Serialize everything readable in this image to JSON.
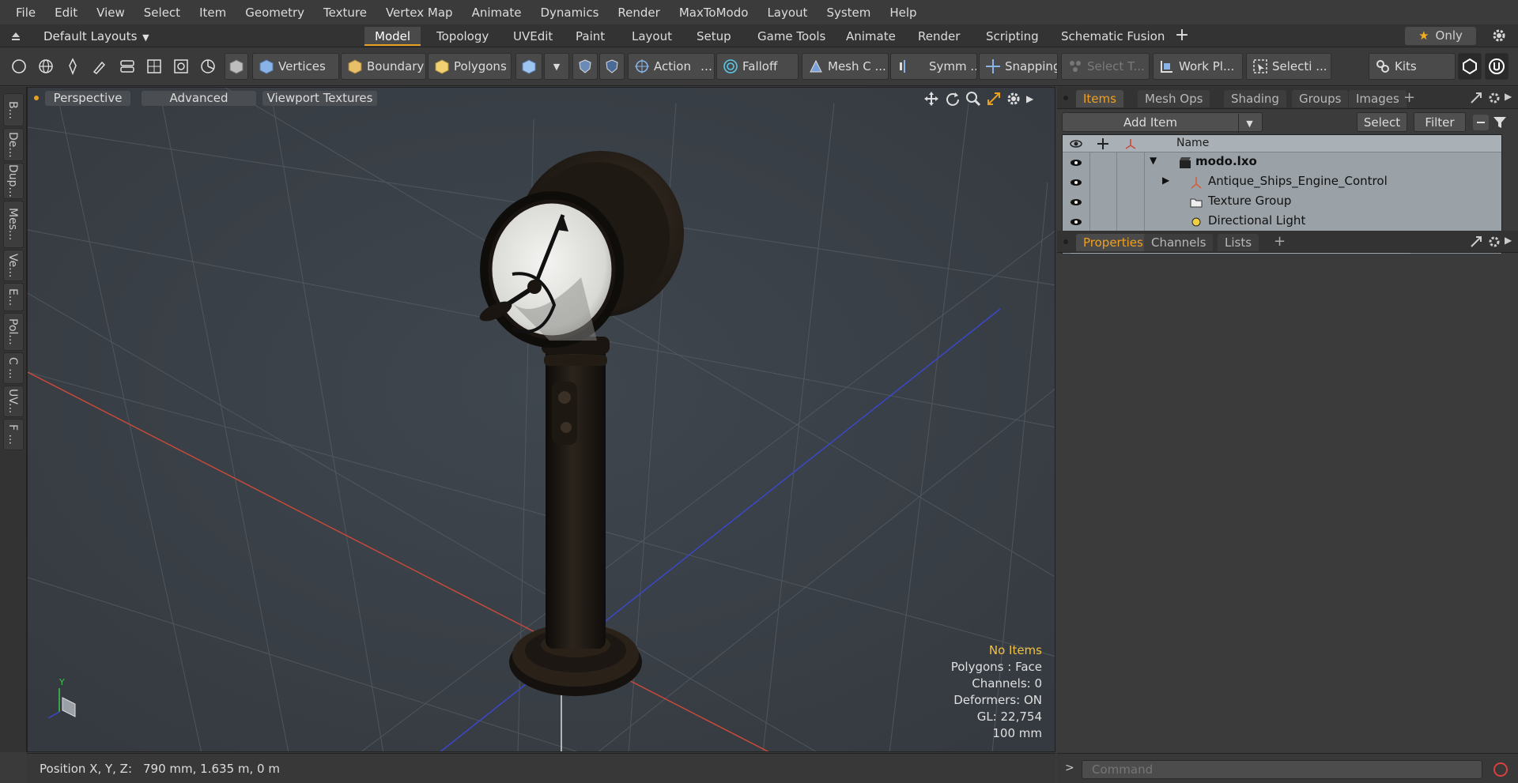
{
  "menubar": {
    "items": [
      "File",
      "Edit",
      "View",
      "Select",
      "Item",
      "Geometry",
      "Texture",
      "Vertex Map",
      "Animate",
      "Dynamics",
      "Render",
      "MaxToModo",
      "Layout",
      "System",
      "Help"
    ]
  },
  "layoutbar": {
    "layouts_label": "Default Layouts",
    "tabs": [
      "Model",
      "Topology",
      "UVEdit",
      "Paint",
      "Layout",
      "Setup",
      "Game Tools",
      "Animate",
      "Render",
      "Scripting",
      "Schematic Fusion"
    ],
    "active_tab": "Model",
    "only_label": "Only"
  },
  "toolbar": {
    "vertices": "Vertices",
    "boundary": "Boundary",
    "polygons": "Polygons",
    "action": "Action",
    "falloff": "Falloff",
    "mesh": "Mesh C ...",
    "symmetry": "Symm ...",
    "snapping": "Snapping",
    "select_t": "Select T...",
    "workplane": "Work Pl...",
    "selection": "Selecti ...",
    "kits": "Kits"
  },
  "leftstrip": {
    "tabs": [
      "B...",
      "De...",
      "Dup...",
      "Mes...",
      "Ve...",
      "E...",
      "Pol...",
      "C ...",
      "UV...",
      "F ..."
    ]
  },
  "viewport": {
    "perspective": "Perspective",
    "advanced": "Advanced",
    "viewport_textures": "Viewport Textures",
    "info": {
      "no_items": "No Items",
      "polygons": "Polygons : Face",
      "channels": "Channels: 0",
      "deformers": "Deformers: ON",
      "gl": "GL: 22,754",
      "scale": "100 mm"
    }
  },
  "statusbar": {
    "label": "Position X, Y, Z:",
    "value": "790 mm, 1.635 m, 0 m"
  },
  "items_panel": {
    "tabs": [
      "Items",
      "Mesh Ops",
      "Shading",
      "Groups",
      "Images"
    ],
    "active_tab": "Items",
    "add_item": "Add Item",
    "select": "Select",
    "filter": "Filter",
    "column_name": "Name",
    "rows": [
      {
        "label": "modo.lxo",
        "bold": true
      },
      {
        "label": "Antique_Ships_Engine_Control",
        "bold": false
      },
      {
        "label": "Texture Group",
        "bold": false
      },
      {
        "label": "Directional Light",
        "bold": false
      }
    ]
  },
  "properties_panel": {
    "tabs": [
      "Properties",
      "Channels",
      "Lists"
    ],
    "active_tab": "Properties"
  },
  "command": {
    "placeholder": "Command"
  },
  "colors": {
    "accent": "#e8a020",
    "viewport_bg": "#3a4048",
    "x_axis": "#c84a3a",
    "z_axis": "#3a48c8"
  }
}
